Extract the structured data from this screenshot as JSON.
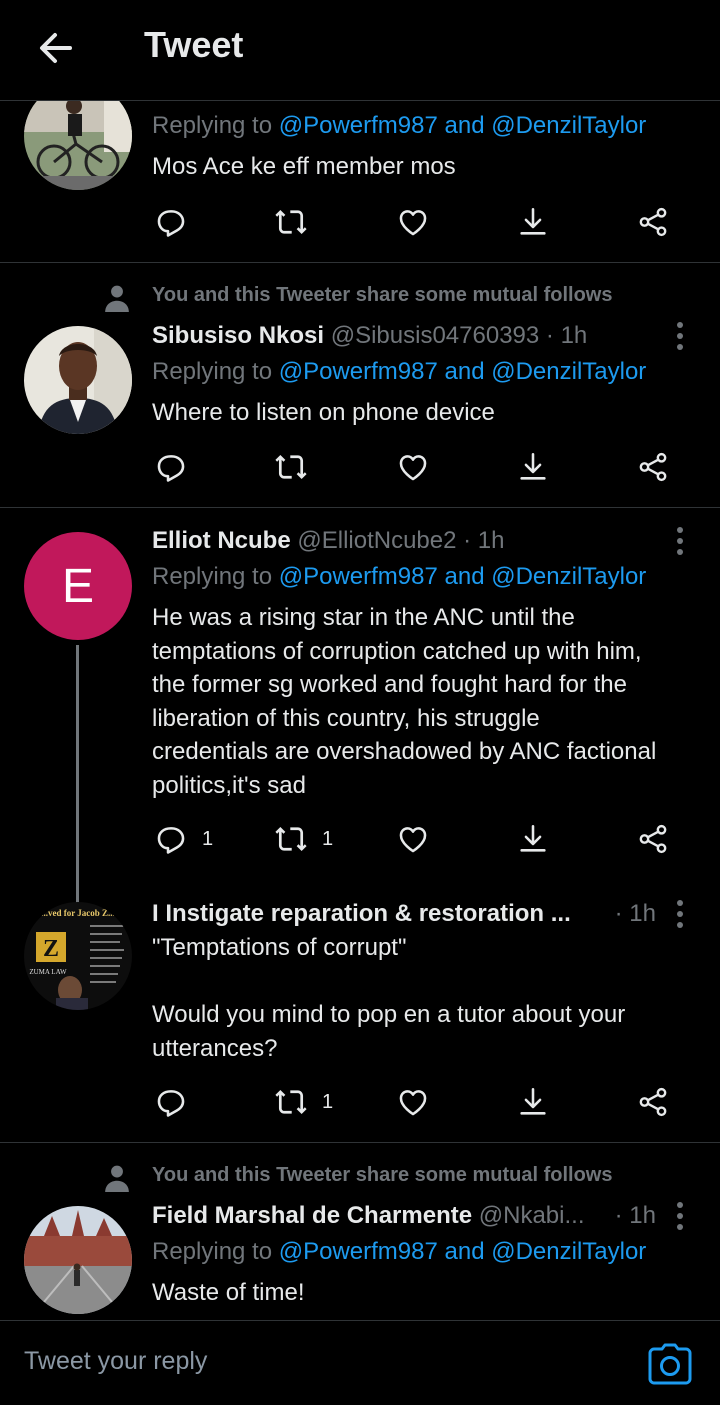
{
  "header": {
    "title": "Tweet"
  },
  "tweets": [
    {
      "replying_prefix": "Replying to ",
      "replying_to": "@Powerfm987 and @DenzilTaylor",
      "text": "Mos Ace ke eff member mos",
      "counts": {
        "reply": "",
        "retweet": "",
        "like": ""
      }
    },
    {
      "social_context": "You and this Tweeter share some mutual follows",
      "name": "Sibusiso Nkosi",
      "handle": "@Sibusis04760393",
      "time": "· 1h",
      "replying_prefix": "Replying to ",
      "replying_to": "@Powerfm987 and @DenzilTaylor",
      "text": "Where to listen on phone device",
      "counts": {
        "reply": "",
        "retweet": "",
        "like": ""
      }
    },
    {
      "avatar_letter": "E",
      "name": "Elliot Ncube",
      "handle": "@ElliotNcube2",
      "time": "· 1h",
      "replying_prefix": "Replying to ",
      "replying_to": "@Powerfm987 and @DenzilTaylor",
      "text": "He was a rising star in the ANC until the\ntemptations of corruption catched up with him,\nthe former sg worked and fought hard for the\nliberation of this country, his struggle\ncredentials are overshadowed by ANC factional\npolitics,it's sad",
      "counts": {
        "reply": "1",
        "retweet": "1",
        "like": ""
      }
    },
    {
      "name": "I Instigate reparation & restoration ...",
      "time": "· 1h",
      "text": "\"Temptations of corrupt\"\n\nWould you mind to pop en a tutor about your\nutterances?",
      "counts": {
        "reply": "",
        "retweet": "1",
        "like": ""
      },
      "avatar_logo_text": "Z",
      "avatar_caption_top": "...ved for Jacob Z...",
      "avatar_caption_bottom": "ZUMA LAW"
    },
    {
      "social_context": "You and this Tweeter share some mutual follows",
      "name": "Field Marshal de Charmente",
      "handle": "@Nkabi...",
      "time": "· 1h",
      "replying_prefix": "Replying to ",
      "replying_to": "@Powerfm987 and @DenzilTaylor",
      "text": "Waste of time!"
    }
  ],
  "composer": {
    "placeholder": "Tweet your reply"
  },
  "colors": {
    "accent": "#1d9bf0",
    "muted": "#71767b",
    "background": "#000000",
    "e_avatar": "#c1185b"
  },
  "icons": [
    "back-arrow-icon",
    "reply-icon",
    "retweet-icon",
    "like-icon",
    "download-icon",
    "share-icon",
    "more-icon",
    "person-icon",
    "camera-icon"
  ]
}
